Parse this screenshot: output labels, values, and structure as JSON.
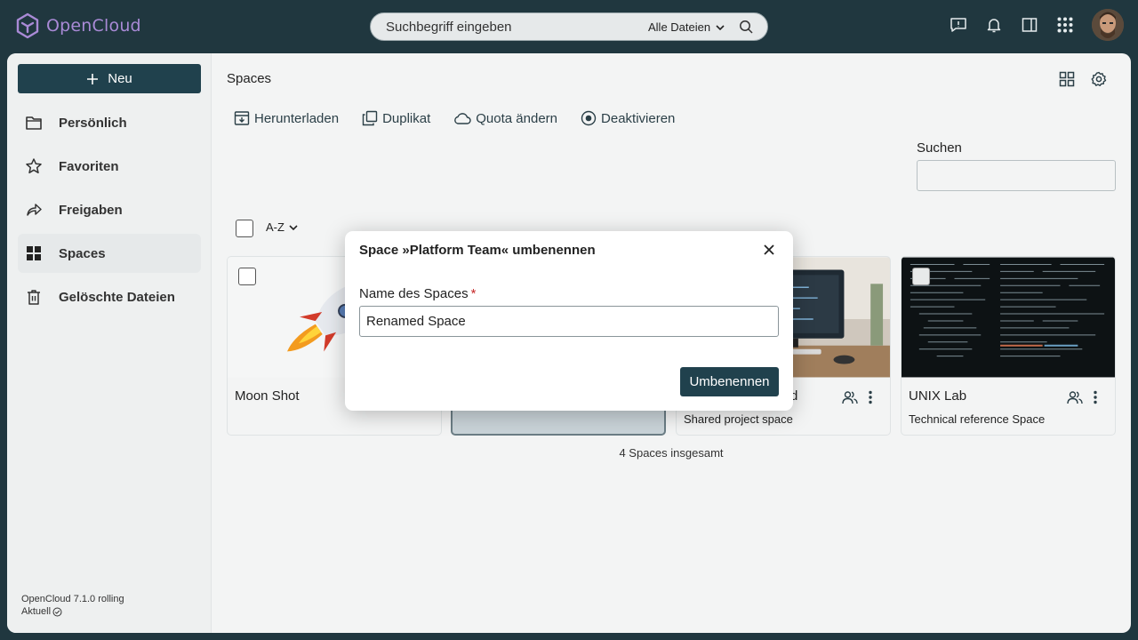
{
  "app": {
    "name": "OpenCloud",
    "brand_color": "#a98ad6",
    "topbar_color": "#20373f"
  },
  "search": {
    "placeholder": "Suchbegriff eingeben",
    "scope": "Alle Dateien"
  },
  "topbar_icons": [
    "feedback-icon",
    "bell-icon",
    "sidebar-panel-icon",
    "apps-grid-icon"
  ],
  "sidebar": {
    "new_label": "Neu",
    "items": [
      {
        "label": "Persönlich",
        "icon": "folder-icon"
      },
      {
        "label": "Favoriten",
        "icon": "star-icon"
      },
      {
        "label": "Freigaben",
        "icon": "share-icon"
      },
      {
        "label": "Spaces",
        "icon": "grid-icon",
        "active": true
      },
      {
        "label": "Gelöschte Dateien",
        "icon": "trash-icon"
      }
    ],
    "version": "OpenCloud 7.1.0 rolling",
    "version_status": "Aktuell"
  },
  "main": {
    "breadcrumb": "Spaces",
    "actions": [
      {
        "label": "Herunterladen",
        "icon": "download-icon"
      },
      {
        "label": "Duplikat",
        "icon": "duplicate-icon"
      },
      {
        "label": "Quota ändern",
        "icon": "cloud-icon"
      },
      {
        "label": "Deaktivieren",
        "icon": "disable-icon"
      }
    ],
    "filter_label": "Suchen",
    "sort_label": "A-Z",
    "cards": [
      {
        "name": "Moon Shot",
        "description": ""
      },
      {
        "name": "",
        "description": ""
      },
      {
        "name": "d",
        "description": "Shared project space"
      },
      {
        "name": "UNIX Lab",
        "description": "Technical reference Space"
      }
    ],
    "total": "4 Spaces insgesamt"
  },
  "modal": {
    "title": "Space »Platform Team« umbenennen",
    "field_label": "Name des Spaces",
    "required_mark": "*",
    "field_value": "Renamed Space",
    "confirm_label": "Umbenennen"
  }
}
